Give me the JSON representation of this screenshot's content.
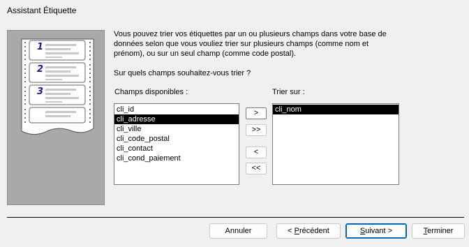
{
  "window": {
    "title": "Assistant Étiquette"
  },
  "description": "Vous pouvez trier vos étiquettes par un ou plusieurs champs dans votre base de données selon que vous vouliez trier sur plusieurs champs (comme nom et prénom), ou sur un seul champ (comme code postal).",
  "question": "Sur quels champs souhaitez-vous trier ?",
  "available": {
    "label": "Champs disponibles :",
    "items": [
      "cli_id",
      "cli_adresse",
      "cli_ville",
      "cli_code_postal",
      "cli_contact",
      "cli_cond_paiement"
    ],
    "selected_index": 1
  },
  "sorted": {
    "label": "Trier sur :",
    "items": [
      "cli_nom"
    ],
    "selected_index": 0
  },
  "move_buttons": {
    "add_one": ">",
    "add_all": ">>",
    "remove_one": "<",
    "remove_all": "<<"
  },
  "illustration": {
    "numbers": [
      "1",
      "2",
      "3"
    ]
  },
  "buttons": {
    "cancel": "Annuler",
    "previous_prefix": "< ",
    "previous_key": "P",
    "previous_rest": "récédent",
    "next_key": "S",
    "next_rest": "uivant >",
    "finish_key": "T",
    "finish_rest": "erminer"
  },
  "colors": {
    "default_button_border": "#0067c0",
    "selection": "#000000",
    "illustration_bg": "#a9a9a9"
  }
}
